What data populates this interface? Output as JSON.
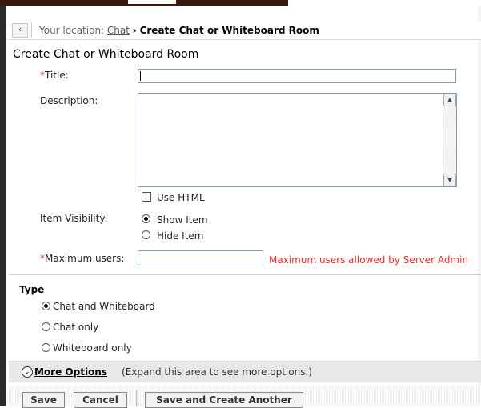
{
  "breadcrumb": {
    "back_icon": "‹",
    "prefix": "Your location:",
    "link": "Chat",
    "arrow": "›",
    "current": "Create Chat or Whiteboard Room"
  },
  "page_title": "Create Chat or Whiteboard Room",
  "form": {
    "required_mark": "*",
    "title_label": "Title:",
    "title_value": "",
    "description_label": "Description:",
    "description_value": "",
    "use_html_label": "Use HTML",
    "use_html_checked": false,
    "visibility_label": "Item Visibility:",
    "visibility_options": [
      {
        "label": "Show Item",
        "selected": true
      },
      {
        "label": "Hide Item",
        "selected": false
      }
    ],
    "max_users_label": "Maximum users:",
    "max_users_value": "",
    "max_users_note": "Maximum users allowed by Server Admin"
  },
  "type_section": {
    "heading": "Type",
    "options": [
      {
        "label": "Chat and Whiteboard",
        "selected": true
      },
      {
        "label": "Chat only",
        "selected": false
      },
      {
        "label": "Whiteboard only",
        "selected": false
      }
    ]
  },
  "more_options": {
    "icon": "double-chevron-down-icon",
    "link": "More Options",
    "description": "(Expand this area to see more options.)"
  },
  "buttons": {
    "save": "Save",
    "cancel": "Cancel",
    "save_and_create": "Save and Create Another"
  },
  "colors": {
    "required": "#e03030",
    "input_border": "#7f9db9"
  }
}
